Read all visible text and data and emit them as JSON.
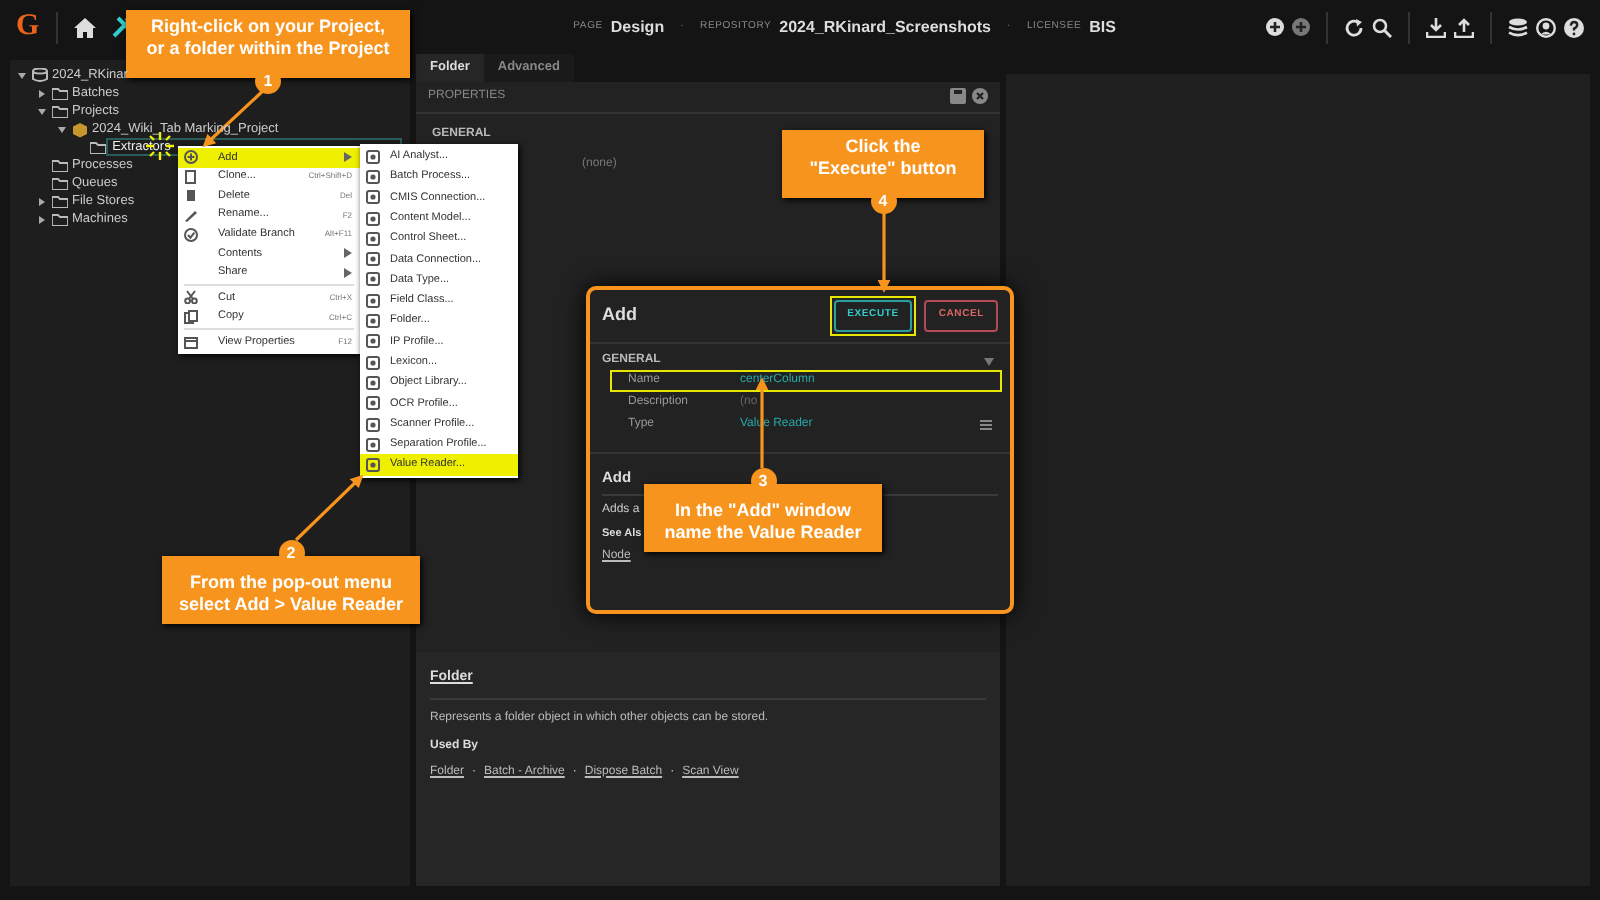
{
  "top_bar": {
    "logo": "G",
    "page_label": "PAGE",
    "page": "Design",
    "repository_label": "REPOSITORY",
    "repository": "2024_RKinard_Screenshots",
    "licensee_label": "LICENSEE",
    "licensee": "BIS",
    "separator": "·"
  },
  "tree": [
    {
      "label": "2024_RKinar",
      "expanded": true,
      "selected": false,
      "children": [
        {
          "label": "Batches",
          "expanded": false,
          "selected": false
        },
        {
          "label": "Projects",
          "expanded": true,
          "selected": false,
          "children": [
            {
              "label": "2024_Wiki_Tab Marking_Project",
              "expanded": true,
              "selected": false,
              "children": [
                {
                  "label": "Extractors",
                  "selected": false,
                  "current": true
                }
              ]
            }
          ]
        },
        {
          "label": "Processes",
          "selected": false
        },
        {
          "label": "Queues",
          "selected": false
        },
        {
          "label": "File Stores",
          "expanded": false,
          "selected": false
        },
        {
          "label": "Machines",
          "expanded": false,
          "selected": false
        }
      ]
    }
  ],
  "tabs": [
    {
      "label": "Folder",
      "selected": true
    },
    {
      "label": "Advanced",
      "selected": false
    }
  ],
  "properties": {
    "title": "PROPERTIES",
    "section": "GENERAL",
    "value": "(none)"
  },
  "help": {
    "title": "Folder",
    "description": "Represents a folder object in which other objects can be stored.",
    "used_by_label": "Used By",
    "links": [
      "Folder",
      "Batch - Archive",
      "Dispose Batch",
      "Scan View"
    ],
    "link_separator": "·"
  },
  "context_menu": {
    "groups": [
      [
        {
          "label": "Add",
          "submenu": true,
          "selected": true
        },
        {
          "label": "Clone...",
          "shortcut": "Ctrl+Shift+D",
          "submenu": false,
          "selected": false
        },
        {
          "label": "Delete",
          "shortcut": "Del",
          "submenu": false,
          "selected": false
        },
        {
          "label": "Rename...",
          "shortcut": "F2",
          "submenu": false,
          "selected": false
        },
        {
          "label": "Validate Branch",
          "shortcut": "Alt+F11",
          "submenu": false,
          "selected": false
        },
        {
          "label": "Contents",
          "submenu": true,
          "selected": false
        },
        {
          "label": "Share",
          "submenu": true,
          "selected": false
        }
      ],
      [
        {
          "label": "Cut",
          "shortcut": "Ctrl+X",
          "submenu": false,
          "selected": false
        },
        {
          "label": "Copy",
          "shortcut": "Ctrl+C",
          "submenu": false,
          "selected": false
        }
      ],
      [
        {
          "label": "View Properties",
          "shortcut": "F12",
          "submenu": false,
          "selected": false
        }
      ]
    ]
  },
  "submenu": [
    {
      "label": "AI Analyst...",
      "selected": false
    },
    {
      "label": "Batch Process...",
      "selected": false
    },
    {
      "label": "CMIS Connection...",
      "selected": false
    },
    {
      "label": "Content Model...",
      "selected": false
    },
    {
      "label": "Control Sheet...",
      "selected": false
    },
    {
      "label": "Data Connection...",
      "selected": false
    },
    {
      "label": "Data Type...",
      "selected": false
    },
    {
      "label": "Field Class...",
      "selected": false
    },
    {
      "label": "Folder...",
      "selected": false
    },
    {
      "label": "IP Profile...",
      "selected": false
    },
    {
      "label": "Lexicon...",
      "selected": false
    },
    {
      "label": "Object Library...",
      "selected": false
    },
    {
      "label": "OCR Profile...",
      "selected": false
    },
    {
      "label": "Scanner Profile...",
      "selected": false
    },
    {
      "label": "Separation Profile...",
      "selected": false
    },
    {
      "label": "Value Reader...",
      "selected": true
    }
  ],
  "dialog": {
    "title": "Add",
    "buttons": [
      {
        "label": "EXECUTE",
        "kind": "primary",
        "highlighted": true
      },
      {
        "label": "CANCEL",
        "kind": "danger",
        "highlighted": false
      }
    ],
    "section": "GENERAL",
    "rows": [
      {
        "label": "Name",
        "value": "centerColumn",
        "highlighted": true,
        "list_button": false
      },
      {
        "label": "Description",
        "value": "(no",
        "highlighted": false,
        "list_button": false
      },
      {
        "label": "Type",
        "value": "Value Reader",
        "highlighted": false,
        "list_button": true
      }
    ],
    "help_title": "Add",
    "help_text": "Adds a",
    "see_also": "See Als",
    "link": "Node"
  },
  "callouts": [
    {
      "number": "1",
      "text": "Right-click on your Project,\nor a folder within the Project"
    },
    {
      "number": "2",
      "text": "From the pop-out menu\nselect Add > Value Reader"
    },
    {
      "number": "3",
      "text": "In the \"Add\" window\nname the Value Reader"
    },
    {
      "number": "4",
      "text": "Click the\n\"Execute\" button"
    }
  ]
}
